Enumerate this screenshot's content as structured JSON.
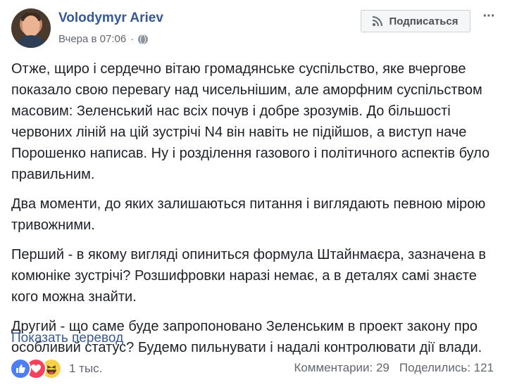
{
  "post": {
    "author": "Volodymyr Ariev",
    "timestamp": "Вчера в 07:06",
    "separator": "·",
    "follow_label": "Подписаться",
    "paragraphs": [
      "Отже, щиро і сердечно вітаю громадянське суспільство, яке вчергове показало свою перевагу над чисельнішим, але аморфним суспільством масовим: Зеленський нас всіх почув і добре зрозумів. До більшості червоних ліній на цій зустрічі N4 він навіть не підійшов, а виступ наче Порошенко написав. Ну і розділення газового і політичного аспектів було правильним.",
      "Два моменти, до яких залишаються питання і виглядають певною мірою тривожними.",
      "Перший - в якому вигляді опиниться формула Штайнмаєра, зазначена в комюніке зустрічі? Розшифровки наразі немає, а в деталях самі знаєте кого можна знайти.",
      "Другий - що саме буде запропоновано Зеленським в проект закону про особливий статус? Будемо пильнувати і надалі контролювати дії влади."
    ],
    "translate_link": "Показать перевод",
    "reactions_count": "1 тыс.",
    "comments": "Комментарии: 29",
    "shares": "Поделились: 121"
  },
  "icons": {
    "follow": "rss-icon",
    "privacy": "globe-icon",
    "menu": "more-options-icon",
    "reactions": [
      "like-icon",
      "love-icon",
      "haha-icon"
    ]
  },
  "colors": {
    "author_link": "#365899",
    "link": "#385898",
    "meta_text": "#616770",
    "like": "#4f7ef0",
    "love": "#f3425f",
    "haha": "#f7d14b"
  }
}
